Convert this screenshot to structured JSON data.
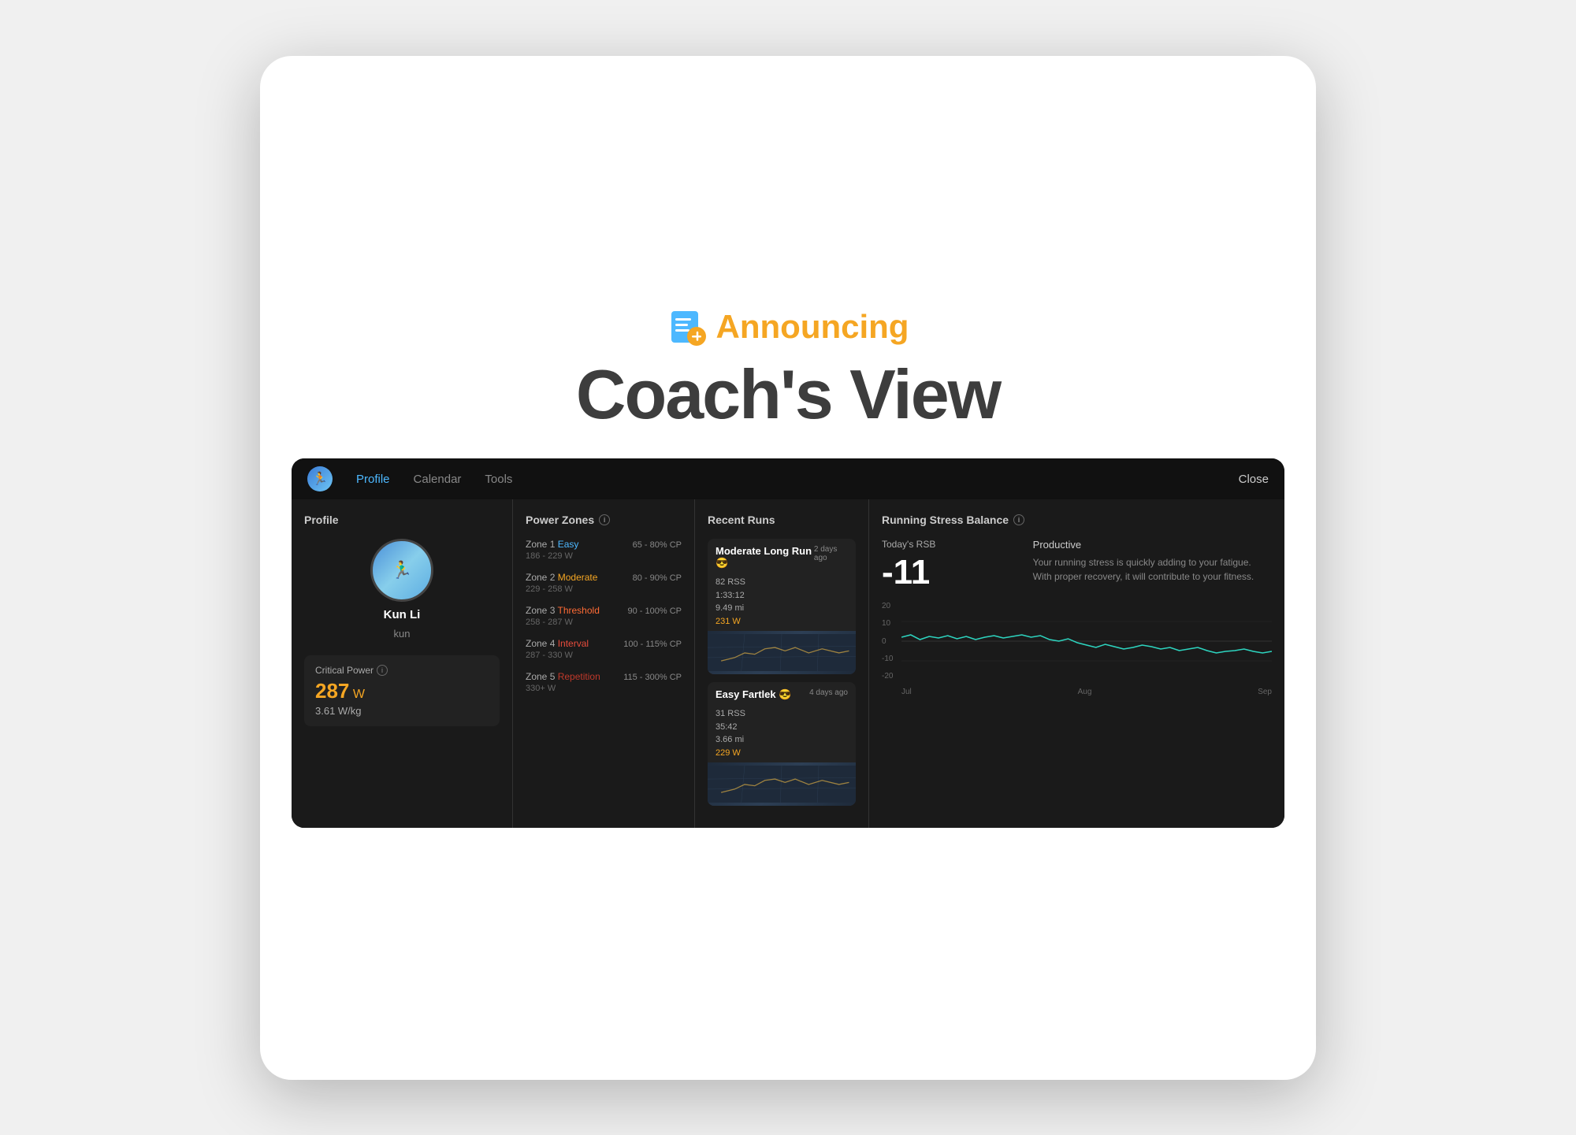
{
  "announcement": {
    "announcing_label": "Announcing",
    "title": "Coach's View",
    "icon_label": "checklist-add-icon"
  },
  "nav": {
    "profile_label": "Profile",
    "calendar_label": "Calendar",
    "tools_label": "Tools",
    "close_label": "Close",
    "active_tab": "Profile"
  },
  "profile_panel": {
    "title": "Profile",
    "name": "Kun Li",
    "username": "kun",
    "critical_power_label": "Critical Power",
    "cp_value": "287",
    "cp_unit": "W",
    "cp_wkg": "3.61 W/kg"
  },
  "power_zones": {
    "title": "Power Zones",
    "zones": [
      {
        "number": "1",
        "name": "Easy",
        "color": "#4db8ff",
        "range_label": "65 - 80% CP",
        "watts": "186 - 229 W"
      },
      {
        "number": "2",
        "name": "Moderate",
        "color": "#f5a623",
        "range_label": "80 - 90% CP",
        "watts": "229 - 258 W"
      },
      {
        "number": "3",
        "name": "Threshold",
        "color": "#ff6b35",
        "range_label": "90 - 100% CP",
        "watts": "258 - 287 W"
      },
      {
        "number": "4",
        "name": "Interval",
        "color": "#e74c3c",
        "range_label": "100 - 115% CP",
        "watts": "287 - 330 W"
      },
      {
        "number": "5",
        "name": "Repetition",
        "color": "#c0392b",
        "range_label": "115 - 300% CP",
        "watts": "330+ W"
      }
    ]
  },
  "recent_runs": {
    "title": "Recent Runs",
    "runs": [
      {
        "date": "2 days ago",
        "title": "Moderate Long Run 😎",
        "rss": "82 RSS",
        "time": "1:33:12",
        "distance": "9.49 mi",
        "watts": "231 W"
      },
      {
        "date": "4 days ago",
        "title": "Easy Fartlek 😎",
        "rss": "31 RSS",
        "time": "35:42",
        "distance": "3.66 mi",
        "watts": "229 W"
      }
    ]
  },
  "rsb": {
    "title": "Running Stress Balance",
    "today_label": "Today's RSB",
    "value": "-11",
    "status": "Productive",
    "description": "Your running stress is quickly adding to your fatigue. With proper recovery, it will contribute to your fitness.",
    "y_labels": [
      "20",
      "10",
      "0",
      "-10",
      "-20"
    ],
    "x_labels": [
      "Jul",
      "Aug",
      "Sep"
    ]
  }
}
